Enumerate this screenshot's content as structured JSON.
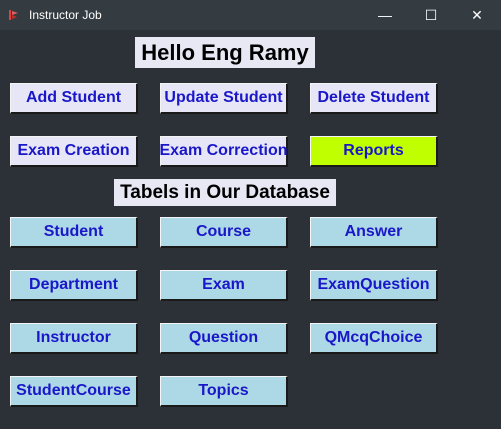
{
  "window": {
    "title": "Instructor Job",
    "minimize_glyph": "—",
    "maximize_glyph": "☐",
    "close_glyph": "✕"
  },
  "greeting": "Hello Eng Ramy",
  "actions": {
    "add_student": "Add Student",
    "update_student": "Update Student",
    "delete_student": "Delete Student",
    "exam_creation": "Exam Creation",
    "exam_correction": "Exam Correction",
    "reports": "Reports"
  },
  "tables_heading": "Tabels in Our Database",
  "tables": {
    "student": "Student",
    "course": "Course",
    "answer": "Answer",
    "department": "Department",
    "exam": "Exam",
    "exam_question": "ExamQuestion",
    "instructor": "Instructor",
    "question": "Question",
    "qmcq_choice": "QMcqChoice",
    "student_course": "StudentCourse",
    "topics": "Topics"
  },
  "colors": {
    "action_button": "#e6e6f7",
    "table_button": "#add8e6",
    "reports_button": "#bfff00",
    "button_text": "#1a17c9",
    "background": "#2b3137"
  },
  "icons": [
    "app-feather-icon",
    "minimize-icon",
    "maximize-icon",
    "close-icon"
  ]
}
